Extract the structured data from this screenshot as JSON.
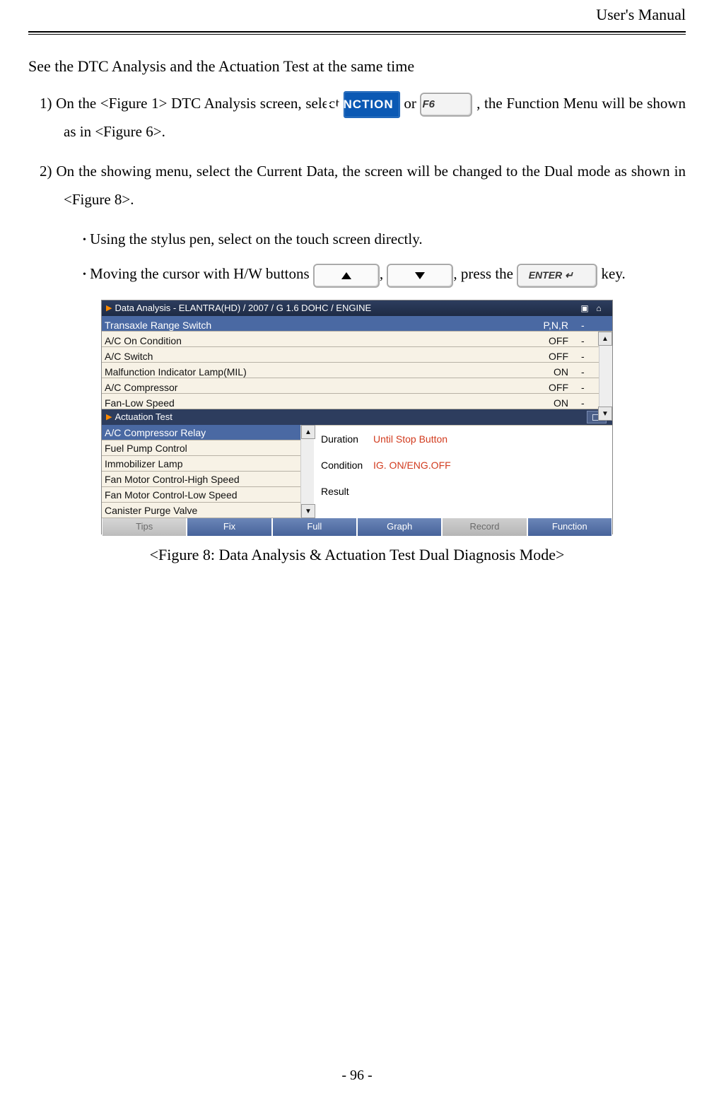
{
  "header": {
    "title": "User's Manual"
  },
  "intro": "See the DTC Analysis and the Actuation Test at the same time",
  "step1": {
    "part1": "1) On the <Figure 1> DTC Analysis screen, select ",
    "function_label": "FUNCTION",
    "part2": " or ",
    "f6_label": "F6",
    "part3": ", the Function Menu will be shown as in <Figure 6>."
  },
  "step2": "2) On the showing menu, select the Current Data, the screen will be changed to the Dual mode as shown in <Figure 8>.",
  "bullet1": "Using the stylus pen, select on the touch screen directly.",
  "bullet2": {
    "part1": "Moving the cursor with H/W buttons ",
    "mid": ", ",
    "part2": ", press the ",
    "enter_label": "ENTER ↵",
    "part3": " key."
  },
  "screenshot": {
    "title": "Data Analysis - ELANTRA(HD) / 2007 / G 1.6 DOHC / ENGINE",
    "data_rows": [
      {
        "name": "Transaxle Range Switch",
        "value": "P,N,R",
        "unit": "-",
        "highlight": true
      },
      {
        "name": "A/C On Condition",
        "value": "OFF",
        "unit": "-",
        "highlight": false
      },
      {
        "name": "A/C Switch",
        "value": "OFF",
        "unit": "-",
        "highlight": false
      },
      {
        "name": "Malfunction Indicator Lamp(MIL)",
        "value": "ON",
        "unit": "-",
        "highlight": false
      },
      {
        "name": "A/C Compressor",
        "value": "OFF",
        "unit": "-",
        "highlight": false
      },
      {
        "name": "Fan-Low Speed",
        "value": "ON",
        "unit": "-",
        "highlight": false
      }
    ],
    "actuation": {
      "header": "Actuation Test",
      "items": [
        {
          "label": "A/C Compressor Relay",
          "selected": true
        },
        {
          "label": "Fuel Pump Control",
          "selected": false
        },
        {
          "label": "Immobilizer Lamp",
          "selected": false
        },
        {
          "label": "Fan Motor Control-High Speed",
          "selected": false
        },
        {
          "label": "Fan Motor Control-Low Speed",
          "selected": false
        },
        {
          "label": "Canister Purge Valve",
          "selected": false
        }
      ],
      "info": {
        "duration_label": "Duration",
        "duration_value": "Until Stop Button",
        "condition_label": "Condition",
        "condition_value": "IG. ON/ENG.OFF",
        "result_label": "Result",
        "result_value": ""
      }
    },
    "bottom_tabs": [
      {
        "label": "Tips",
        "state": "disabled"
      },
      {
        "label": "Fix",
        "state": "active"
      },
      {
        "label": "Full",
        "state": "active"
      },
      {
        "label": "Graph",
        "state": "active"
      },
      {
        "label": "Record",
        "state": "darkdisabled"
      },
      {
        "label": "Function",
        "state": "active"
      }
    ]
  },
  "caption": "<Figure 8: Data Analysis & Actuation Test Dual Diagnosis Mode>",
  "page_number": "- 96 -"
}
